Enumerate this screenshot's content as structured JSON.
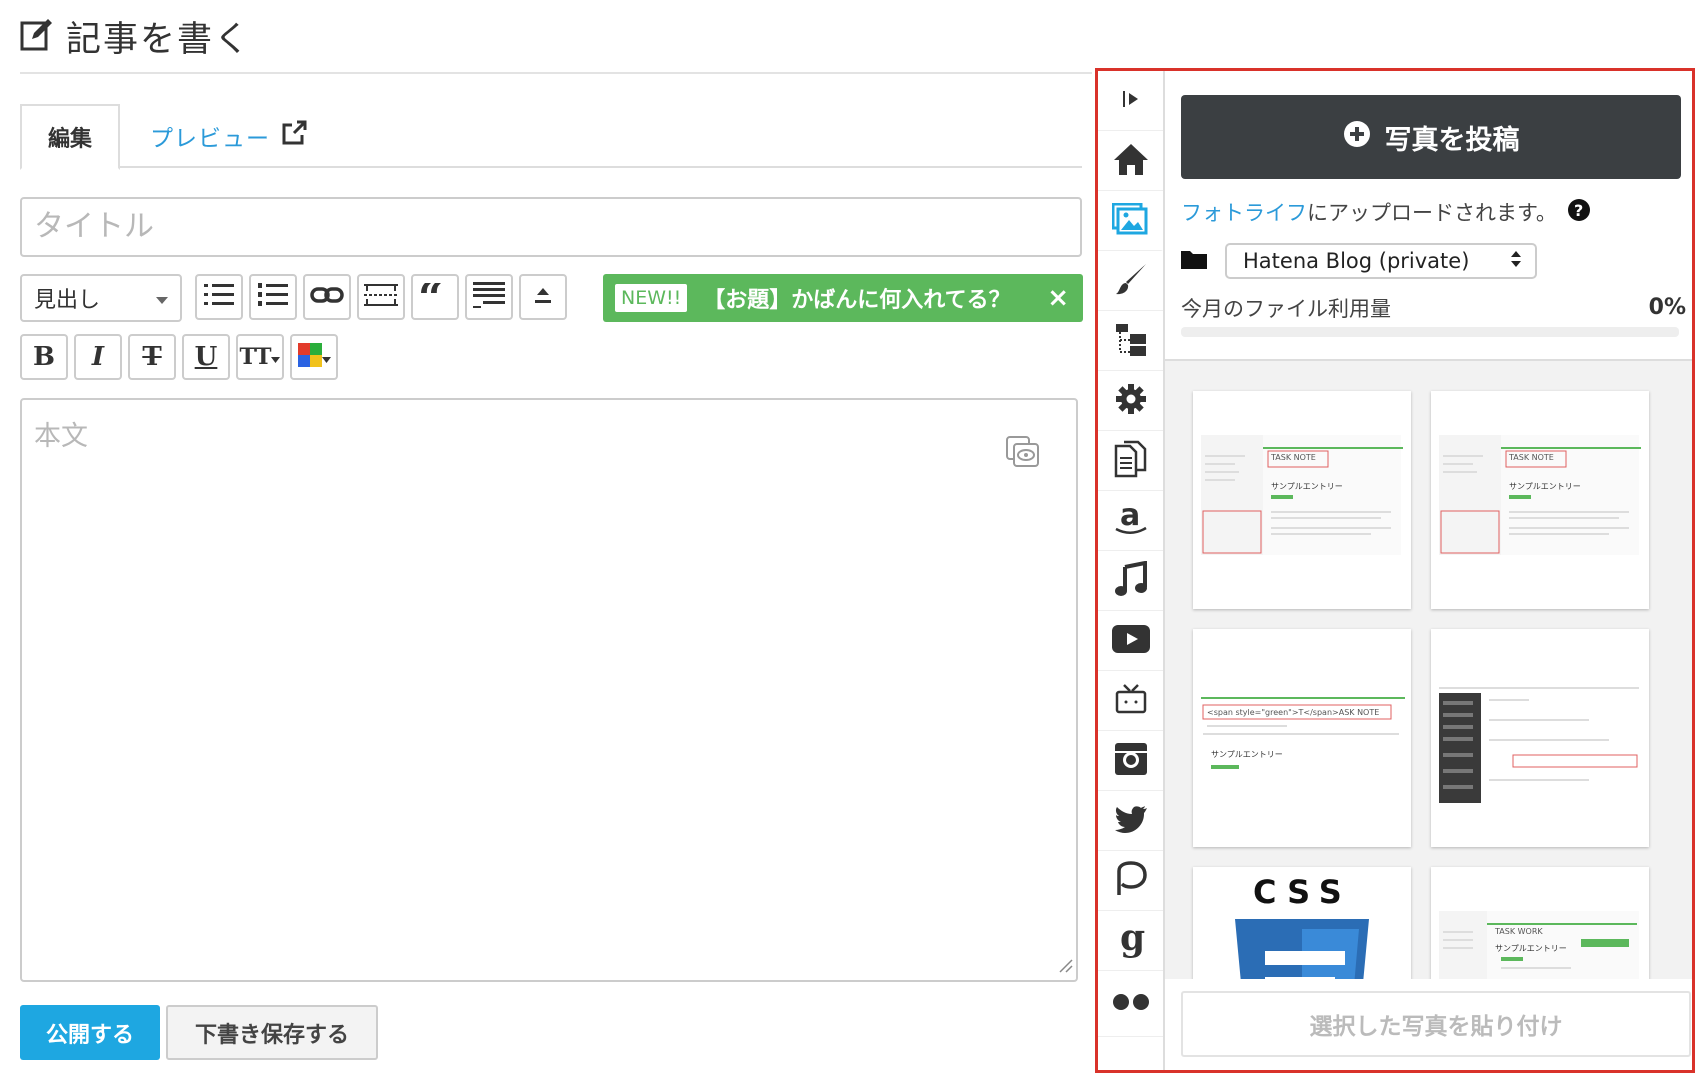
{
  "header": {
    "title": "記事を書く"
  },
  "tabs": {
    "edit": "編集",
    "preview": "プレビュー"
  },
  "title_field": {
    "placeholder": "タイトル"
  },
  "toolbar": {
    "heading_select": "見出し",
    "banner_badge": "NEW!!",
    "banner_text": "【お題】かばんに何入れてる？",
    "banner_close": "×",
    "bold": "B",
    "italic": "I",
    "strike": "T",
    "underline": "U",
    "size": "TT"
  },
  "body_field": {
    "placeholder": "本文"
  },
  "actions": {
    "publish": "公開する",
    "save_draft": "下書き保存する"
  },
  "sidebar": {
    "upload_button": "写真を投稿",
    "upload_note_link": "フォトライフ",
    "upload_note_text": "にアップロードされます。",
    "blog_select": "Hatena Blog (private)",
    "usage_label": "今月のファイル利用量",
    "usage_value": "0%",
    "usage_fraction": 0,
    "paste_button": "選択した写真を貼り付け",
    "thumbs": [
      {
        "heading": "TASK NOTE",
        "entry": "サンプルエントリー"
      },
      {
        "heading": "TASK NOTE",
        "entry": "サンプルエントリー"
      },
      {
        "heading": "<span style=\"green\">T</span>ASK NOTE",
        "entry": "サンプルエントリー"
      },
      {
        "heading": "",
        "entry": ""
      },
      {
        "heading": "CSS",
        "entry": ""
      },
      {
        "heading": "TASK WORK",
        "entry": "サンプルエントリー"
      }
    ]
  },
  "colors": {
    "accent": "#1ea7e1",
    "banner": "#5cb85c",
    "upload": "#3b3f42",
    "sidebar_border": "#d9322a"
  }
}
